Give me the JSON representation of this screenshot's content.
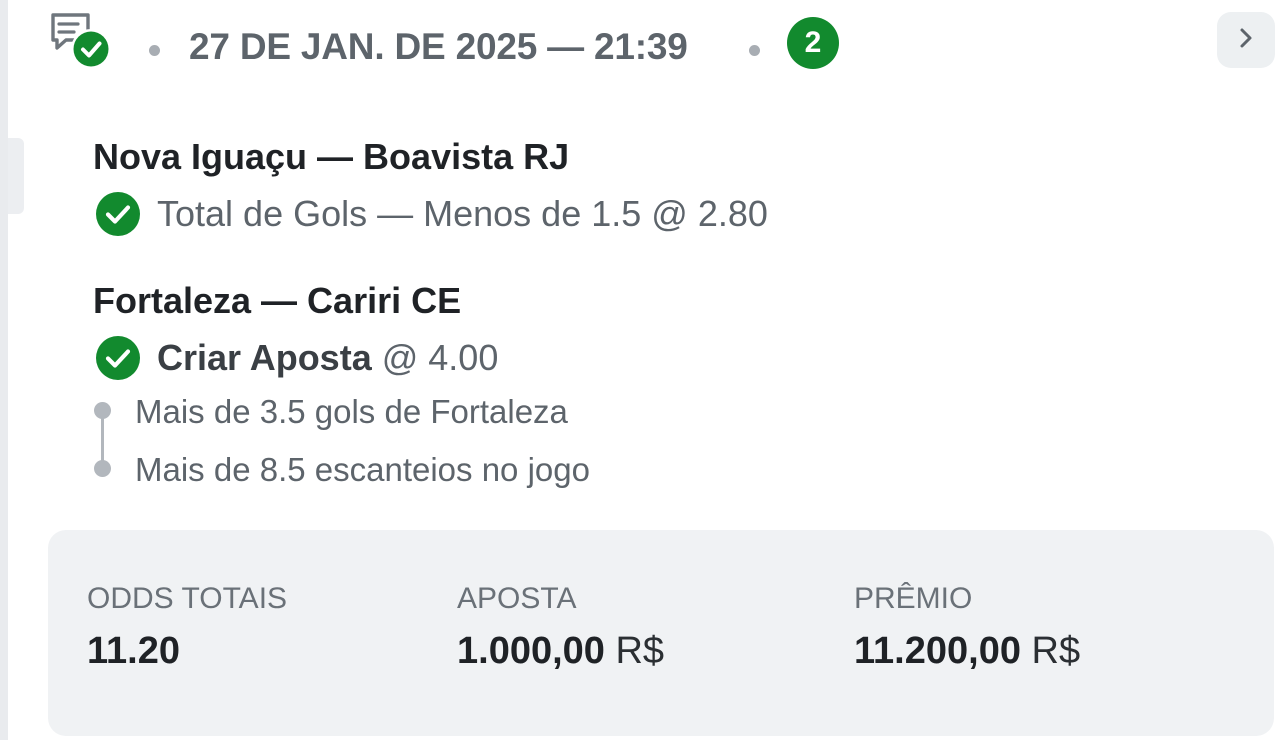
{
  "header": {
    "date_time": "27 DE JAN. DE 2025 — 21:39",
    "selections_count": "2",
    "icon": "receipt-check-icon",
    "nav_icon": "chevron-right-icon"
  },
  "matches": [
    {
      "title": "Nova Iguaçu — Boavista RJ",
      "status_icon": "check-circle-icon",
      "market": "Total de Gols — Menos de 1.5",
      "odds": "@ 2.80"
    },
    {
      "title": "Fortaleza — Cariri CE",
      "status_icon": "check-circle-icon",
      "market": "Criar Aposta",
      "odds": "@ 4.00",
      "legs": [
        "Mais de 3.5 gols de Fortaleza",
        "Mais de 8.5 escanteios no jogo"
      ]
    }
  ],
  "summary": {
    "odds_label": "ODDS TOTAIS",
    "odds_value": "11.20",
    "stake_label": "APOSTA",
    "stake_value": "1.000,00",
    "stake_currency": "R$",
    "prize_label": "PRÊMIO",
    "prize_value": "11.200,00",
    "prize_currency": "R$"
  },
  "colors": {
    "success": "#128a2e",
    "muted_text": "#5d646b",
    "panel_bg": "#f0f2f4"
  }
}
